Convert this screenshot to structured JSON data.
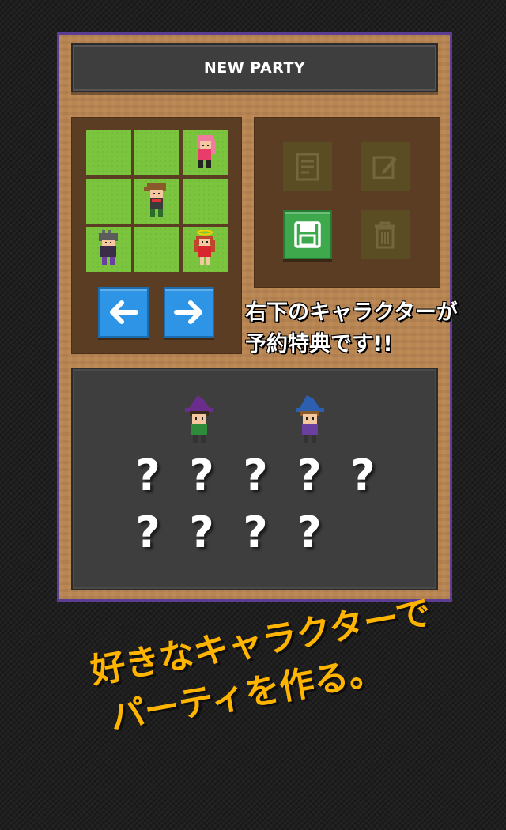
{
  "screen": {
    "title": "NEW PARTY",
    "caption_lines": [
      "右下のキャラクターが",
      "予約特典です!!"
    ],
    "tagline_lines": [
      "好きなキャラクターで",
      "パーティを作る。"
    ]
  },
  "formation_grid": {
    "cells": [
      {
        "occupant": ""
      },
      {
        "occupant": ""
      },
      {
        "occupant": "pink-haired-girl"
      },
      {
        "occupant": ""
      },
      {
        "occupant": "brown-haired-hero"
      },
      {
        "occupant": ""
      },
      {
        "occupant": "gray-haired-warrior"
      },
      {
        "occupant": ""
      },
      {
        "occupant": "red-haired-girl-with-halo"
      }
    ]
  },
  "navigation": {
    "prev_icon": "arrow-left-icon",
    "next_icon": "arrow-right-icon"
  },
  "tools": [
    {
      "icon": "document-icon",
      "state": "disabled"
    },
    {
      "icon": "edit-icon",
      "state": "disabled"
    },
    {
      "icon": "save-icon",
      "state": "active"
    },
    {
      "icon": "trash-icon",
      "state": "disabled"
    }
  ],
  "roster": {
    "characters": [
      "green-witch",
      "blue-witch"
    ],
    "unknown_slots": [
      "?",
      "?",
      "?",
      "?",
      "?",
      "?",
      "?",
      "?",
      "?"
    ]
  },
  "colors": {
    "frame_border": "#5b3d94",
    "panel_wood": "#b98551",
    "grass": "#7ac43e",
    "arrow_blue": "#2e95e6",
    "save_green": "#3da84c",
    "tagline": "#ffb400"
  }
}
